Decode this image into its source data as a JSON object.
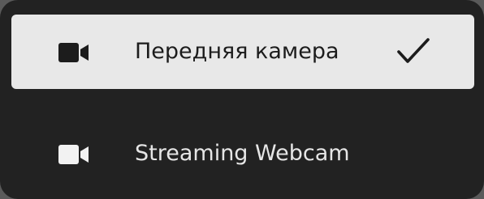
{
  "camera_menu": {
    "items": [
      {
        "label": "Передняя камера",
        "icon": "video-camera-icon",
        "selected": true,
        "indicator_icon": "checkmark-icon"
      },
      {
        "label": "Streaming Webcam",
        "icon": "video-camera-icon",
        "selected": false
      }
    ]
  },
  "colors": {
    "menu_background": "#222222",
    "selected_background": "#e8e8e8",
    "selected_text": "#1c1c1c",
    "normal_text": "#e6e6e6"
  }
}
